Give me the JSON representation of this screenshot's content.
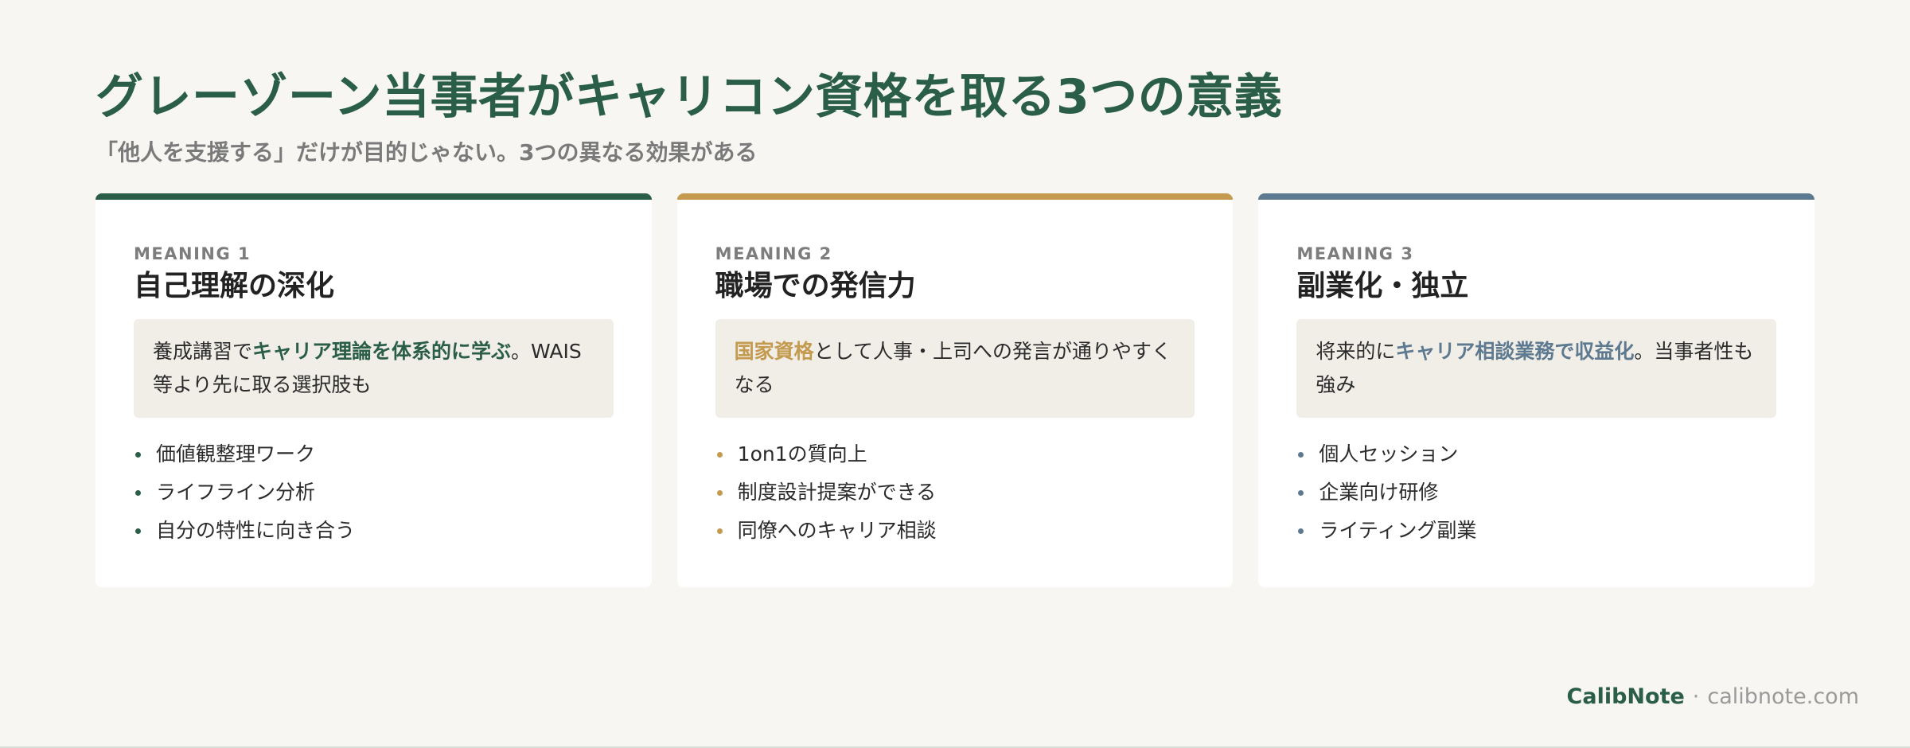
{
  "header": {
    "title": "グレーゾーン当事者がキャリコン資格を取る3つの意義",
    "subtitle": "「他人を支援する」だけが目的じゃない。3つの異なる効果がある"
  },
  "cards": [
    {
      "kicker": "MEANING 1",
      "title": "自己理解の深化",
      "accent": "#2a5e48",
      "box": {
        "before": "養成講習で",
        "highlight": "キャリア理論を体系的に学ぶ",
        "after": "。WAIS等より先に取る選択肢も"
      },
      "bullets": [
        "価値観整理ワーク",
        "ライフライン分析",
        "自分の特性に向き合う"
      ]
    },
    {
      "kicker": "MEANING 2",
      "title": "職場での発信力",
      "accent": "#c49a4e",
      "box": {
        "before": "",
        "highlight": "国家資格",
        "after": "として人事・上司への発言が通りやすくなる"
      },
      "bullets": [
        "1on1の質向上",
        "制度設計提案ができる",
        "同僚へのキャリア相談"
      ]
    },
    {
      "kicker": "MEANING 3",
      "title": "副業化・独立",
      "accent": "#5e7a91",
      "box": {
        "before": "将来的に",
        "highlight": "キャリア相談業務で収益化",
        "after": "。当事者性も強み"
      },
      "bullets": [
        "個人セッション",
        "企業向け研修",
        "ライティング副業"
      ]
    }
  ],
  "footer": {
    "brand": "CalibNote",
    "separator": "·",
    "url": "calibnote.com"
  }
}
